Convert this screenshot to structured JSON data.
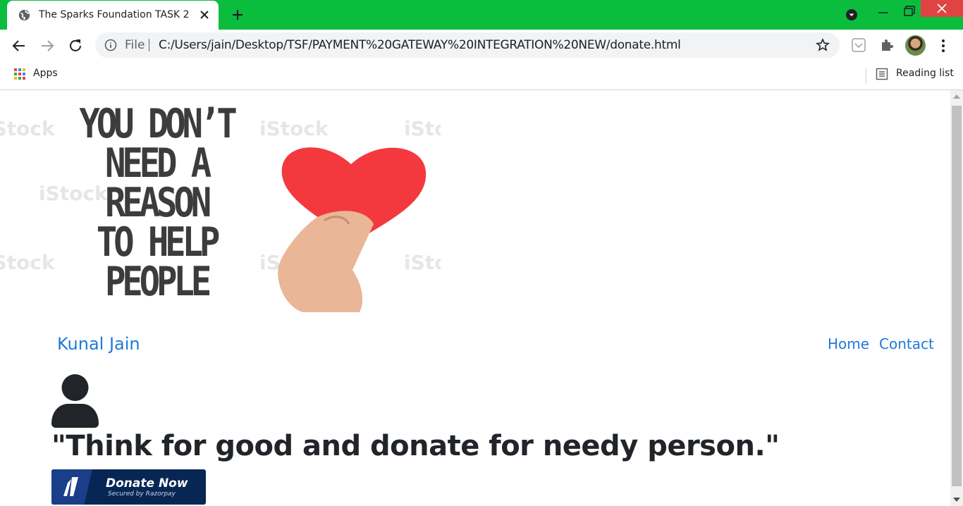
{
  "browser": {
    "tab_title": "The Sparks Foundation TASK 2",
    "scheme_label": "File",
    "url": "C:/Users/jain/Desktop/TSF/PAYMENT%20GATEWAY%20INTEGRATION%20NEW/donate.html",
    "bookmarks": {
      "apps_label": "Apps",
      "reading_list_label": "Reading list"
    },
    "accent_color": "#0bbd3d"
  },
  "banner": {
    "slogan_lines": [
      "YOU DON’T",
      "NEED A",
      "REASON",
      "TO HELP",
      "PEOPLE"
    ],
    "watermark": "iStock"
  },
  "navbar": {
    "brand": "Kunal Jain",
    "links": [
      "Home",
      "Contact"
    ]
  },
  "main": {
    "quote": "\"Think for good and donate for needy person.\"",
    "donate_button": {
      "label": "Donate Now",
      "sublabel": "Secured by Razorpay"
    }
  }
}
